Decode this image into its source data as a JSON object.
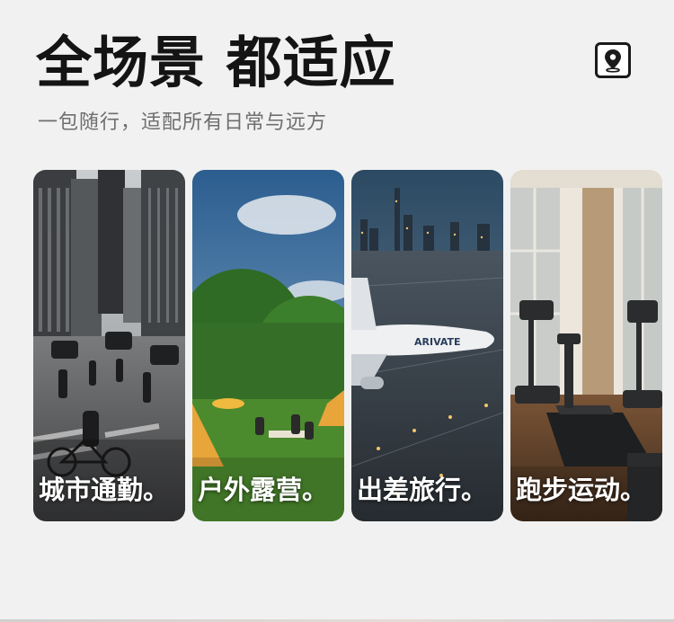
{
  "header": {
    "title": "全场景 都适应",
    "subtitle": "一包随行，适配所有日常与远方",
    "icon": "location-pin-icon"
  },
  "cards": [
    {
      "label": "城市通勤。",
      "icon": "city-commute-image"
    },
    {
      "label": "户外露营。",
      "icon": "outdoor-camping-image"
    },
    {
      "label": "出差旅行。",
      "icon": "business-travel-image"
    },
    {
      "label": "跑步运动。",
      "icon": "running-exercise-image"
    }
  ],
  "plane_text": "ARIVATE"
}
